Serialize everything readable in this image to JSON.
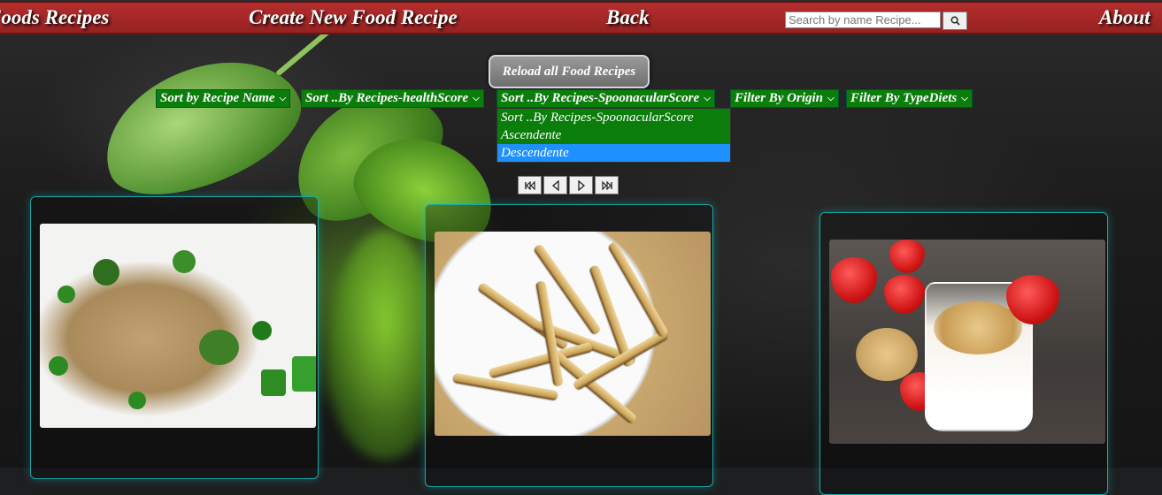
{
  "nav": {
    "brand": "Foods Recipes",
    "create": "Create New Food Recipe",
    "back": "Back",
    "about": "About",
    "search_placeholder": "Search by name Recipe..."
  },
  "controls": {
    "reload_label": "Reload all Food Recipes",
    "sort_name": "Sort by Recipe Name",
    "sort_health": "Sort ..By Recipes-healthScore",
    "sort_spoonacular": "Sort ..By Recipes-SpoonacularScore",
    "filter_origin": "Filter By Origin",
    "filter_diets": "Filter By TypeDiets",
    "dropdown_options": [
      "Sort ..By Recipes-SpoonacularScore",
      "Ascendente",
      "Descendente"
    ],
    "dropdown_highlighted": "Descendente"
  },
  "pagination": {
    "first_icon": "skip-first-icon",
    "prev_icon": "triangle-left-icon",
    "next_icon": "triangle-right-icon",
    "last_icon": "skip-last-icon"
  },
  "colors": {
    "navbar": "#a82727",
    "select_bg": "#0a7d0a",
    "dropdown_highlight": "#1e90ff",
    "card_border": "#1aa6a6"
  },
  "cards": [
    {
      "image_icon": "rice-broccoli-dish-icon"
    },
    {
      "image_icon": "roasted-fries-plate-icon"
    },
    {
      "image_icon": "strawberry-smoothie-glass-icon"
    }
  ]
}
